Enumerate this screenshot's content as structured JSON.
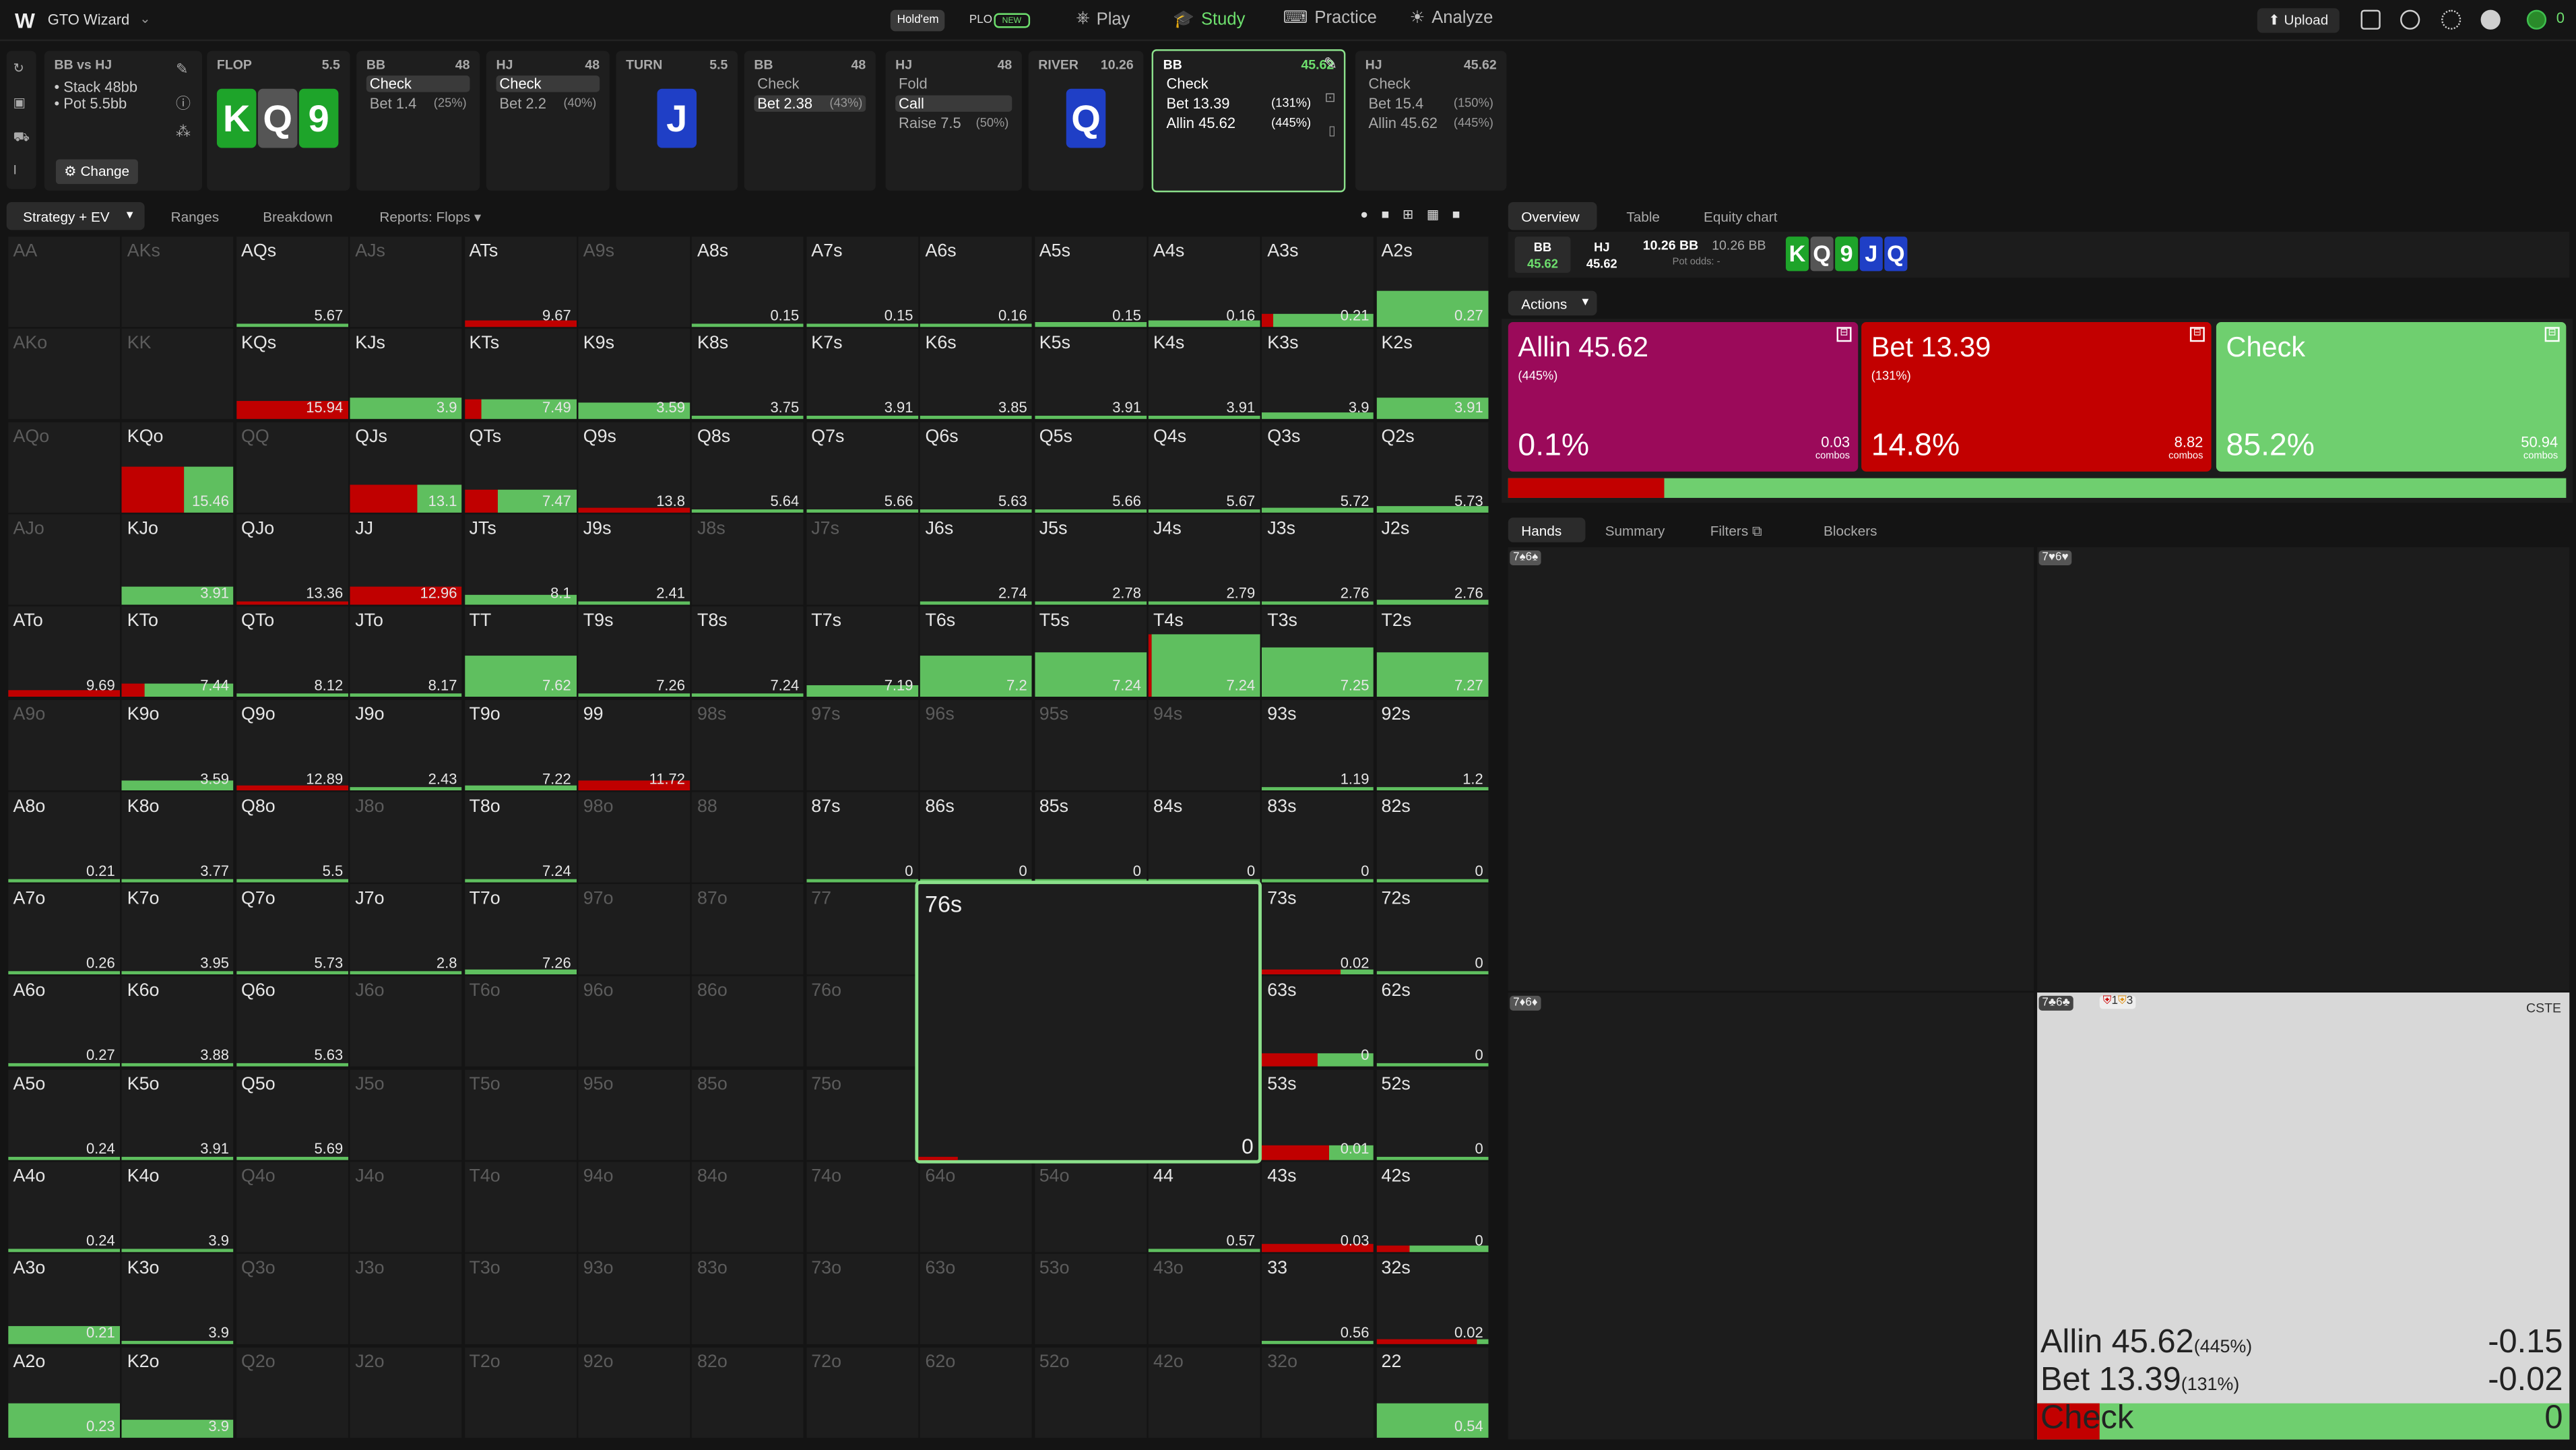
{
  "app": {
    "logo": "W",
    "name": "GTO Wizard",
    "game_tabs": [
      "Hold'em",
      "PLO"
    ],
    "plo_badge": "NEW",
    "nav": [
      "Play",
      "Study",
      "Practice",
      "Analyze"
    ],
    "upload": "Upload"
  },
  "spot": {
    "title": "BB vs HJ",
    "stack": "Stack 48bb",
    "pot": "Pot 5.5bb",
    "change": "Change"
  },
  "streets": [
    {
      "id": "flop",
      "pos": "FLOP",
      "val": "5.5"
    },
    {
      "id": "bb1",
      "pos": "BB",
      "val": "48",
      "rows": [
        {
          "a": "Check",
          "p": "",
          "sel": true
        },
        {
          "a": "Bet 1.4",
          "p": "(25%)"
        }
      ]
    },
    {
      "id": "hj1",
      "pos": "HJ",
      "val": "48",
      "rows": [
        {
          "a": "Check",
          "p": "",
          "sel": true
        },
        {
          "a": "Bet 2.2",
          "p": "(40%)"
        }
      ]
    },
    {
      "id": "turn",
      "pos": "TURN",
      "val": "5.5"
    },
    {
      "id": "bb2",
      "pos": "BB",
      "val": "48",
      "rows": [
        {
          "a": "Check",
          "p": ""
        },
        {
          "a": "Bet 2.38",
          "p": "(43%)",
          "sel": true
        }
      ]
    },
    {
      "id": "hj2",
      "pos": "HJ",
      "val": "48",
      "rows": [
        {
          "a": "Fold",
          "p": ""
        },
        {
          "a": "Call",
          "p": "",
          "sel": true
        },
        {
          "a": "Raise 7.5",
          "p": "(50%)"
        }
      ]
    },
    {
      "id": "river",
      "pos": "RIVER",
      "val": "10.26"
    },
    {
      "id": "bb3",
      "pos": "BB",
      "val": "45.62",
      "rows": [
        {
          "a": "Check",
          "p": ""
        },
        {
          "a": "Bet 13.39",
          "p": "(131%)"
        },
        {
          "a": "Allin 45.62",
          "p": "(445%)"
        }
      ]
    },
    {
      "id": "hj3",
      "pos": "HJ",
      "val": "45.62",
      "rows": [
        {
          "a": "Check",
          "p": ""
        },
        {
          "a": "Bet 15.4",
          "p": "(150%)"
        },
        {
          "a": "Allin 45.62",
          "p": "(445%)"
        }
      ]
    }
  ],
  "board": {
    "flop": [
      "K",
      "Q",
      "9"
    ],
    "turn": "J",
    "river": "Q"
  },
  "left_tabs": {
    "strategy": "Strategy + EV",
    "ranges": "Ranges",
    "breakdown": "Breakdown",
    "reports": "Reports: Flops"
  },
  "matrix": [
    [
      "AA|d|",
      "AKs|d|",
      "AQs||5.67",
      "AJs|d|",
      "ATs||9.67",
      "A9s|d|",
      "A8s||0.15",
      "A7s||0.15",
      "A6s||0.16",
      "A5s||0.15",
      "A4s||0.16",
      "A3s||0.21",
      "A2s||0.27"
    ],
    [
      "AKo|d|",
      "KK|d|",
      "KQs||15.94",
      "KJs||3.9",
      "KTs||7.49",
      "K9s||3.59",
      "K8s||3.75",
      "K7s||3.91",
      "K6s||3.85",
      "K5s||3.91",
      "K4s||3.91",
      "K3s||3.9",
      "K2s||3.91"
    ],
    [
      "AQo|d|",
      "KQo||15.46",
      "QQ|d|",
      "QJs||13.1",
      "QTs||7.47",
      "Q9s||13.8",
      "Q8s||5.64",
      "Q7s||5.66",
      "Q6s||5.63",
      "Q5s||5.66",
      "Q4s||5.67",
      "Q3s||5.72",
      "Q2s||5.73"
    ],
    [
      "AJo|d|",
      "KJo||3.91",
      "QJo||13.36",
      "JJ||12.96",
      "JTs||8.1",
      "J9s||2.41",
      "J8s|d|",
      "J7s|d|",
      "J6s||2.74",
      "J5s||2.78",
      "J4s||2.79",
      "J3s||2.76",
      "J2s||2.76"
    ],
    [
      "ATo||9.69",
      "KTo||7.44",
      "QTo||8.12",
      "JTo||8.17",
      "TT||7.62",
      "T9s||7.26",
      "T8s||7.24",
      "T7s||7.19",
      "T6s||7.2",
      "T5s||7.24",
      "T4s||7.24",
      "T3s||7.25",
      "T2s||7.27"
    ],
    [
      "A9o|d|",
      "K9o||3.59",
      "Q9o||12.89",
      "J9o||2.43",
      "T9o||7.22",
      "99||11.72",
      "98s|d|",
      "97s|d|",
      "96s|d|",
      "95s|d|",
      "94s|d|",
      "93s||1.19",
      "92s||1.2"
    ],
    [
      "A8o||0.21",
      "K8o||3.77",
      "Q8o||5.5",
      "J8o|d|",
      "T8o||7.24",
      "98o|d|",
      "88|d|",
      "87s||0",
      "86s||0",
      "85s||0",
      "84s||0",
      "83s||0",
      "82s||0"
    ],
    [
      "A7o||0.26",
      "K7o||3.95",
      "Q7o||5.73",
      "J7o||2.8",
      "T7o||7.26",
      "97o|d|",
      "87o|d|",
      "77|d|",
      "76s||0",
      "76s||0",
      "76s||0",
      "73s||0.02",
      "72s||0"
    ],
    [
      "A6o||0.27",
      "K6o||3.88",
      "Q6o||5.63",
      "J6o|d|",
      "T6o|d|",
      "96o|d|",
      "86o|d|",
      "76o|d|",
      "x||",
      "x||",
      "x||",
      "63s||0",
      "62s||0"
    ],
    [
      "A5o||0.24",
      "K5o||3.91",
      "Q5o||5.69",
      "J5o|d|",
      "T5o|d|",
      "95o|d|",
      "85o|d|",
      "75o|d|",
      "x||",
      "x||",
      "x||",
      "53s||0.01",
      "52s||0"
    ],
    [
      "A4o||0.24",
      "K4o||3.9",
      "Q4o|d|",
      "J4o|d|",
      "T4o|d|",
      "94o|d|",
      "84o|d|",
      "74o|d|",
      "64o|d|",
      "54o|d|",
      "44||0.57",
      "43s||0.03",
      "42s||0"
    ],
    [
      "A3o||0.21",
      "K3o||3.9",
      "Q3o|d|",
      "J3o|d|",
      "T3o|d|",
      "93o|d|",
      "83o|d|",
      "73o|d|",
      "63o|d|",
      "53o|d|",
      "43o|d|",
      "33||0.56",
      "32s||0.02"
    ],
    [
      "A2o||0.23",
      "K2o||3.9",
      "Q2o|d|",
      "J2o|d|",
      "T2o|d|",
      "92o|d|",
      "82o|d|",
      "72o|d|",
      "62o|d|",
      "52o|d|",
      "42o|d|",
      "32o|d|",
      "22||0.54"
    ]
  ],
  "zoom": {
    "label": "76s",
    "value": "0"
  },
  "right_tabs": {
    "overview": "Overview",
    "table": "Table",
    "equity": "Equity chart"
  },
  "pot_info": {
    "bb": "BB",
    "bb_stack": "45.62",
    "hj": "HJ",
    "hj_stack": "45.62",
    "pot": "10.26 BB",
    "pot2": "10.26 BB",
    "pot_odds": "Pot odds:",
    "pot_odds_val": "-"
  },
  "actions_label": "Actions",
  "actions": [
    {
      "name": "Allin 45.62",
      "size": "(445%)",
      "pct": "85.2%",
      "pct_real": "0.1%",
      "combos": "0.03",
      "combos_label": "combos",
      "color": "#9b0a5a"
    },
    {
      "name": "Bet 13.39",
      "size": "(131%)",
      "pct_real": "14.8%",
      "combos": "8.82",
      "combos_label": "combos",
      "color": "#c20000"
    },
    {
      "name": "Check",
      "size": "",
      "pct_real": "85.2%",
      "combos": "50.94",
      "combos_label": "combos",
      "color": "#6fcf6f"
    }
  ],
  "hand_tabs": {
    "hands": "Hands",
    "summary": "Summary",
    "filters": "Filters",
    "blockers": "Blockers"
  },
  "hands": [
    {
      "label": "7♠6♠"
    },
    {
      "label": "7♥6♥"
    },
    {
      "label": "7♦6♦"
    },
    {
      "label": "7♣6♣"
    }
  ],
  "hand_detail": {
    "badge": "CSTE",
    "blk1": "1",
    "blk2": "3",
    "rows": [
      {
        "a": "Allin 45.62",
        "p": "(445%)",
        "ev": "-0.15"
      },
      {
        "a": "Bet 13.39",
        "p": "(131%)",
        "ev": "-0.02"
      },
      {
        "a": "Check",
        "p": "",
        "ev": "0"
      }
    ]
  }
}
